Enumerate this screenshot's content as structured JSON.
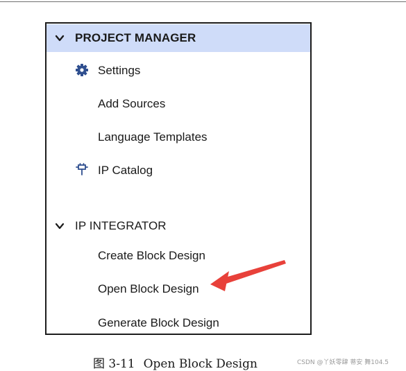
{
  "panel": {
    "project_manager": {
      "header": "PROJECT MANAGER",
      "items": [
        {
          "label": "Settings",
          "icon": "gear-icon"
        },
        {
          "label": "Add Sources"
        },
        {
          "label": "Language Templates"
        },
        {
          "label": "IP Catalog",
          "icon": "ip-plug-icon"
        }
      ]
    },
    "ip_integrator": {
      "header": "IP INTEGRATOR",
      "items": [
        {
          "label": "Create Block Design"
        },
        {
          "label": "Open Block Design"
        },
        {
          "label": "Generate Block Design"
        }
      ]
    }
  },
  "caption": {
    "figure_number": "图 3-11",
    "title": "Open Block Design"
  },
  "watermark": "CSDN @丫妖零肆 蒂安 舞104.5",
  "colors": {
    "header_highlight": "#cfdcf9",
    "arrow": "#e8413a",
    "icon": "#2f4f8f"
  }
}
